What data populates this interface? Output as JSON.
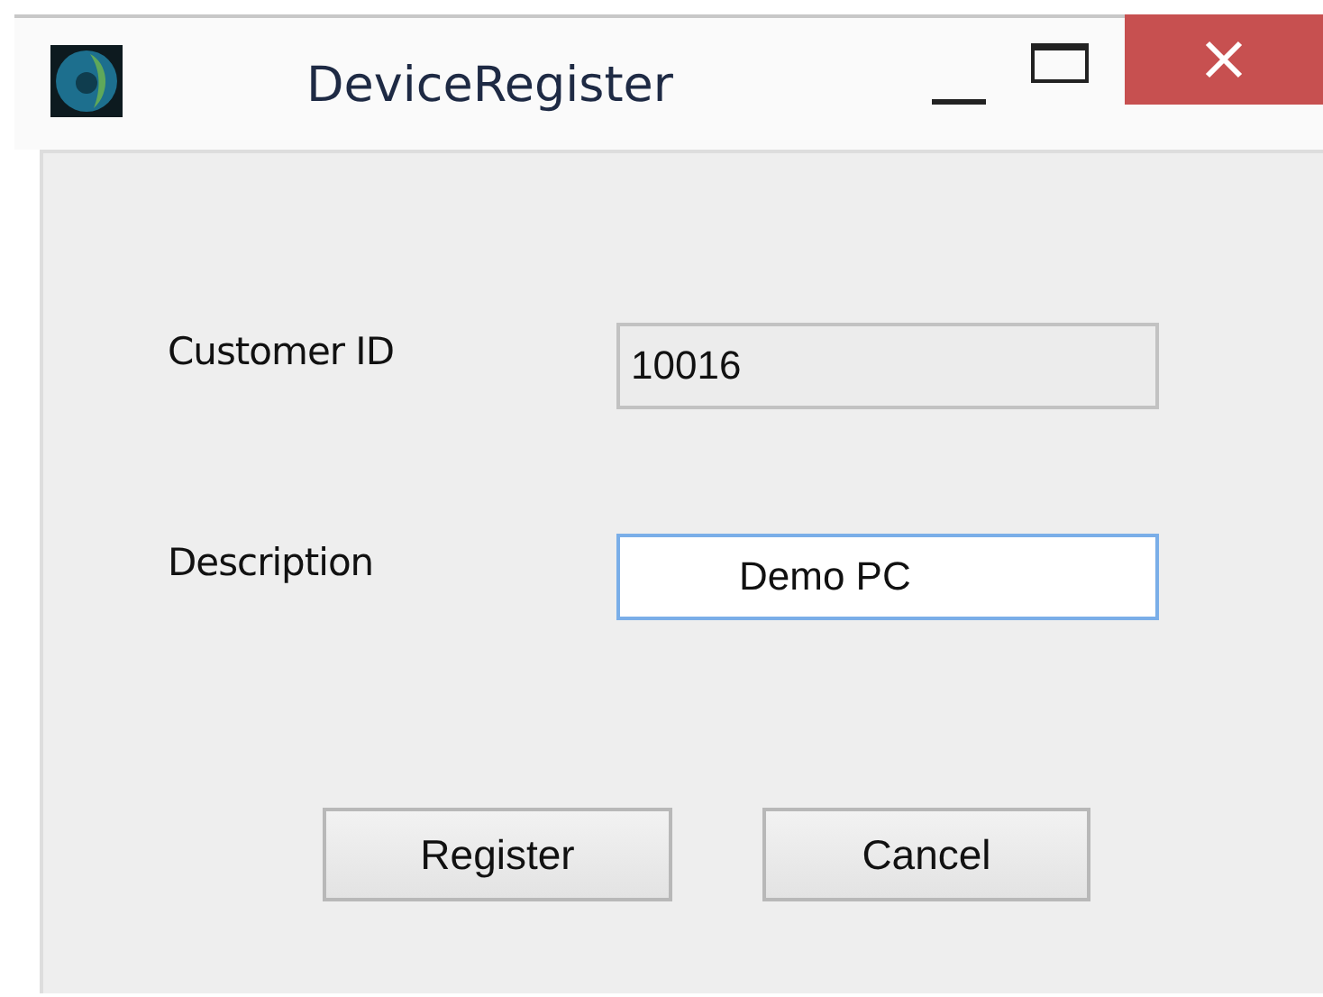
{
  "window": {
    "title": "DeviceRegister"
  },
  "fields": [
    {
      "label": "Customer ID",
      "value": "10016",
      "disabled": true,
      "focused": false
    },
    {
      "label": "Description",
      "value": "Demo PC",
      "disabled": false,
      "focused": true
    }
  ],
  "buttons": [
    "Register",
    "Cancel"
  ]
}
